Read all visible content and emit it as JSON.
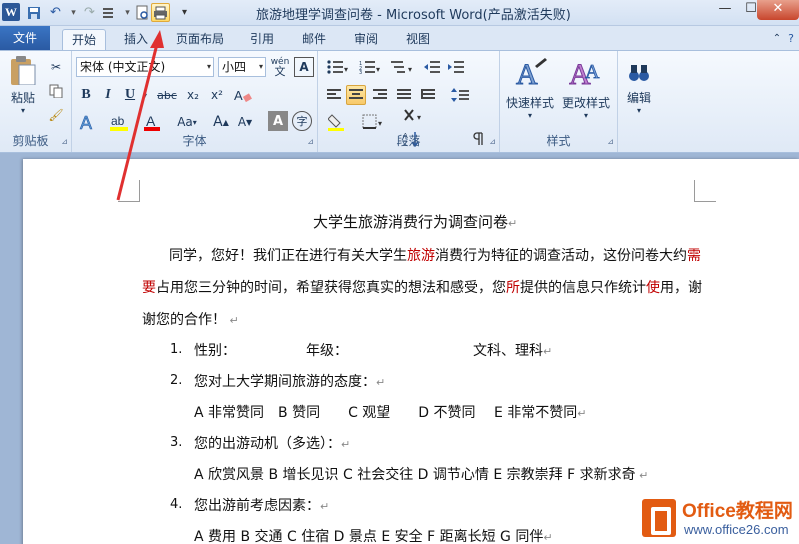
{
  "window": {
    "title": "旅游地理学调查问卷 - Microsoft Word(产品激活失败)",
    "app_icon": "W",
    "controls": {
      "minimize": "—",
      "maximize": "☐",
      "close": "✕"
    }
  },
  "quick_access": {
    "icons": [
      "save-icon",
      "undo-icon",
      "redo-icon",
      "format-icon",
      "print-preview-icon",
      "quick-print-icon",
      "customize-icon"
    ]
  },
  "tabs": [
    {
      "label": "文件"
    },
    {
      "label": "开始"
    },
    {
      "label": "插入"
    },
    {
      "label": "页面布局"
    },
    {
      "label": "引用"
    },
    {
      "label": "邮件"
    },
    {
      "label": "审阅"
    },
    {
      "label": "视图"
    }
  ],
  "ribbon": {
    "clipboard": {
      "label": "剪贴板",
      "paste": "粘贴"
    },
    "font": {
      "label": "字体",
      "font_name": "宋体 (中文正文)",
      "font_size": "小四",
      "bold": "B",
      "italic": "I",
      "underline": "U",
      "strike": "abc",
      "subscript": "x₂",
      "superscript": "x²",
      "change_case": "Aa",
      "grow": "A",
      "shrink": "A",
      "clear": "A",
      "phonetic": "wén",
      "border": "A",
      "enclose": "字"
    },
    "paragraph": {
      "label": "段落"
    },
    "styles": {
      "label": "样式",
      "quick_styles": "快速样式",
      "change_styles": "更改样式"
    },
    "editing": {
      "label": "编辑"
    }
  },
  "document": {
    "title": "大学生旅游消费行为调查问卷",
    "intro": [
      {
        "parts": [
          [
            "同学，您好！我们正在进行有关大学生",
            ""
          ],
          [
            "旅游",
            "red"
          ],
          [
            "消费行为特征的调查活动，这份问卷大约",
            ""
          ],
          [
            "需",
            "red"
          ]
        ]
      },
      {
        "parts": [
          [
            "要",
            "red"
          ],
          [
            "占用您三分钟的时间，希望获得您真实的想法和感受，您",
            ""
          ],
          [
            "所",
            "red"
          ],
          [
            "提供的信息只作统计",
            ""
          ],
          [
            "使",
            "red"
          ],
          [
            "用，谢",
            ""
          ]
        ]
      },
      {
        "parts": [
          [
            "谢您的合作！",
            ""
          ]
        ]
      }
    ],
    "q1": {
      "num": "1.",
      "gender": "性别：",
      "grade": "年级：",
      "track": "文科、理科"
    },
    "q2": {
      "num": "2.",
      "text": "您对上大学期间旅游的态度：",
      "options": "A 非常赞同　B 赞同　　C 观望　　D 不赞同　 E 非常不赞同"
    },
    "q3": {
      "num": "3.",
      "text": "您的出游动机（多选）：",
      "options": "A 欣赏风景 B 增长见识 C 社会交往 D 调节心情 E 宗教崇拜 F 求新求奇"
    },
    "q4": {
      "num": "4.",
      "text": "您出游前考虑因素：",
      "options": "A 费用 B 交通 C 住宿 D 景点 E 安全 F 距离长短 G 同伴"
    },
    "para_mark": "↵"
  },
  "watermark": {
    "line1": "Office教程网",
    "line2": "www.office26.com"
  }
}
